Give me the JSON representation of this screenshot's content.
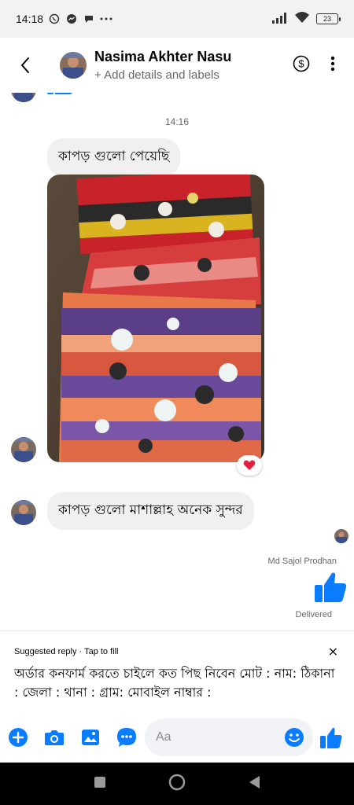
{
  "status_bar": {
    "time": "14:18",
    "battery": "23",
    "icons": [
      "whatsapp-icon",
      "messenger-icon",
      "chat-icon",
      "more-dots-icon",
      "signal-icon",
      "wifi-icon",
      "battery-icon"
    ]
  },
  "header": {
    "name": "Nasima Akhter Nasu",
    "subtitle": "+ Add details and labels",
    "icons": [
      "back-arrow-icon",
      "dollar-icon",
      "vertical-dots-icon"
    ]
  },
  "chat": {
    "timestamp": "14:16",
    "messages": [
      {
        "sender": "them",
        "type": "text",
        "text": "কাপড় গুলো  পেয়েছি"
      },
      {
        "sender": "them",
        "type": "photo",
        "reaction": "heart"
      },
      {
        "sender": "them",
        "type": "text",
        "text": "কাপড় গুলো  মাশাল্লাহ  অনেক সুন্দর"
      },
      {
        "sender": "me",
        "type": "like",
        "sender_name": "Md Sajol Prodhan",
        "status": "Delivered"
      }
    ]
  },
  "suggested_reply": {
    "label": "Suggested reply · Tap to fill",
    "text": "অর্ডার কনফার্ম করতে চাইলে কত পিছ নিবেন মোট : নাম: ঠিকানা : জেলা : থানা : গ্রাম: মোবাইল নাম্বার :",
    "close": "×"
  },
  "composer": {
    "placeholder": "Aa",
    "icons": [
      "plus-icon",
      "camera-icon",
      "gallery-icon",
      "chat-bubble-icon",
      "emoji-icon",
      "thumbs-up-icon"
    ]
  },
  "colors": {
    "accent": "#0a7cff",
    "bubble": "#f0f0f0",
    "secondary_text": "#65676b",
    "heart": "#e41e3f"
  }
}
